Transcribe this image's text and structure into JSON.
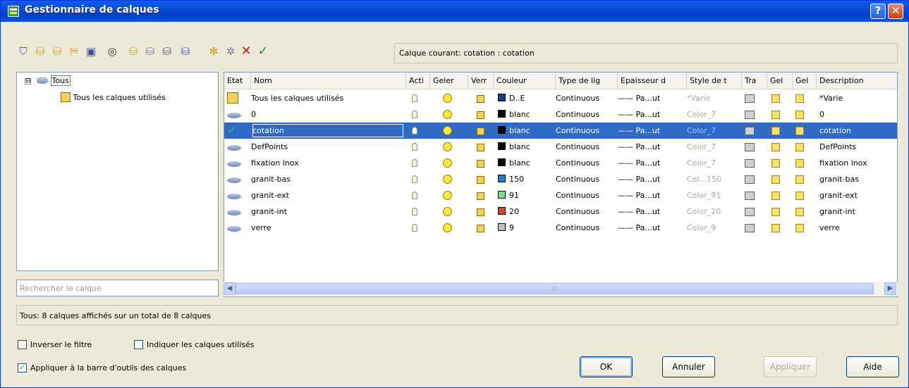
{
  "window": {
    "title": "Gestionnaire de calques",
    "help": "?",
    "close": "✕"
  },
  "toolbar": {
    "icons": [
      "new-filter-icon",
      "group-filter-icon",
      "state-manager-icon",
      "new-layer-vp-icon",
      "save-icon",
      "find-icon",
      "new-layer-icon",
      "new-layer-frozen-icon",
      "delete-layer-icon",
      "set-current-icon",
      "refresh-icon",
      "settings-icon",
      "delete-icon",
      "apply-icon"
    ],
    "current_layer": "Calque courant: cotation : cotation"
  },
  "tree": {
    "root": "Tous",
    "root_box": "⊟",
    "child": "Tous les calques utilisés"
  },
  "search": {
    "placeholder": "Rechercher le calque"
  },
  "columns": [
    "Etat",
    "Nom",
    "Acti",
    "Geler",
    "Verr",
    "Couleur",
    "Type de lig",
    "Epaisseur d",
    "Style de t",
    "Tra",
    "Gel",
    "Gel",
    "Description"
  ],
  "rows": [
    {
      "name": "Tous les calques utilisés",
      "color": "D..E",
      "color_hex": "#1f3b8c",
      "linetype": "Continuous",
      "lineweight": "—— Pa...ut",
      "plotstyle": "*Varie",
      "desc": "*Varie",
      "selected": false,
      "current": false,
      "icon": "all-layers-icon"
    },
    {
      "name": "0",
      "color": "blanc",
      "color_hex": "#000000",
      "linetype": "Continuous",
      "lineweight": "—— Pa...ut",
      "plotstyle": "Color_7",
      "desc": "0",
      "selected": false,
      "current": false,
      "icon": "layer-icon"
    },
    {
      "name": "cotation",
      "color": "blanc",
      "color_hex": "#000000",
      "linetype": "Continuous",
      "lineweight": "—— Pa...ut",
      "plotstyle": "Color_7",
      "desc": "cotation",
      "selected": true,
      "current": true,
      "icon": "current-check-icon"
    },
    {
      "name": "DefPoints",
      "color": "blanc",
      "color_hex": "#000000",
      "linetype": "Continuous",
      "lineweight": "—— Pa...ut",
      "plotstyle": "Color_7",
      "desc": "DefPoints",
      "selected": false,
      "current": false,
      "icon": "layer-icon"
    },
    {
      "name": "fixation inox",
      "color": "blanc",
      "color_hex": "#000000",
      "linetype": "Continuous",
      "lineweight": "—— Pa...ut",
      "plotstyle": "Color_7",
      "desc": "fixation inox",
      "selected": false,
      "current": false,
      "icon": "layer-icon"
    },
    {
      "name": "granit-bas",
      "color": "150",
      "color_hex": "#1c7fe0",
      "linetype": "Continuous",
      "lineweight": "—— Pa...ut",
      "plotstyle": "Col...150",
      "desc": "granit-bas",
      "selected": false,
      "current": false,
      "icon": "layer-icon"
    },
    {
      "name": "granit-ext",
      "color": "91",
      "color_hex": "#7be08a",
      "linetype": "Continuous",
      "lineweight": "—— Pa...ut",
      "plotstyle": "Color_91",
      "desc": "granit-ext",
      "selected": false,
      "current": false,
      "icon": "layer-icon"
    },
    {
      "name": "granit-int",
      "color": "20",
      "color_hex": "#e0421c",
      "linetype": "Continuous",
      "lineweight": "—— Pa...ut",
      "plotstyle": "Color_20",
      "desc": "granit-int",
      "selected": false,
      "current": false,
      "icon": "layer-icon"
    },
    {
      "name": "verre",
      "color": "9",
      "color_hex": "#c0c0c0",
      "linetype": "Continuous",
      "lineweight": "—— Pa...ut",
      "plotstyle": "Color_9",
      "desc": "verre",
      "selected": false,
      "current": false,
      "icon": "layer-icon"
    }
  ],
  "status": "Tous: 8 calques affichés sur un total de 8 calques",
  "options": {
    "invert_filter": "Inverser le filtre",
    "show_used": "Indiquer les calques utilisés",
    "apply_toolbar": "Appliquer à la barre d'outils des calques",
    "invert_checked": false,
    "show_used_checked": false,
    "apply_checked": true
  },
  "buttons": {
    "ok": "OK",
    "cancel": "Annuler",
    "apply": "Appliquer",
    "help": "Aide"
  }
}
